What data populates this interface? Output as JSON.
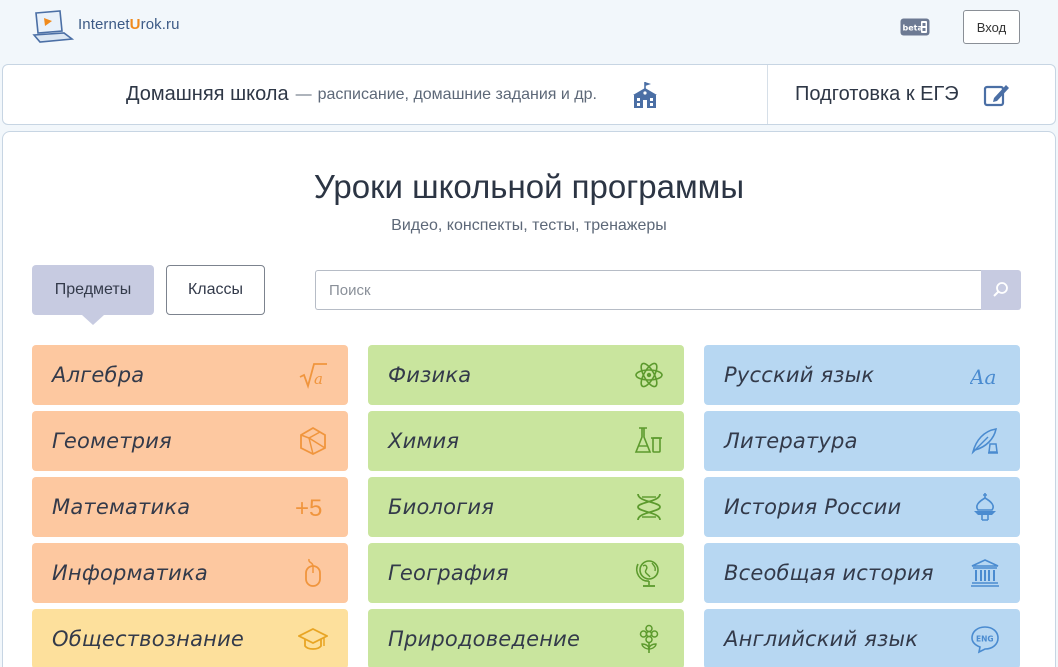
{
  "header": {
    "logo_prefix": "Internet",
    "logo_accent": "U",
    "logo_suffix": "rok.ru",
    "beta_label": "beta",
    "login_label": "Вход"
  },
  "topbar": {
    "home_school_title": "Домашняя школа",
    "dash": "—",
    "home_school_subtitle": "расписание, домашние задания и др.",
    "ege_title": "Подготовка к ЕГЭ"
  },
  "main": {
    "title": "Уроки школьной программы",
    "subtitle": "Видео, конспекты, тесты, тренажеры",
    "tab_subjects": "Предметы",
    "tab_classes": "Классы",
    "search_placeholder": "Поиск"
  },
  "subjects": {
    "col1": [
      {
        "label": "Алгебра",
        "icon": "square-root-icon",
        "color": "#fdc8a0"
      },
      {
        "label": "Геометрия",
        "icon": "polyhedron-icon",
        "color": "#fdc8a0"
      },
      {
        "label": "Математика",
        "icon": "plus-five-icon",
        "color": "#fdc8a0"
      },
      {
        "label": "Информатика",
        "icon": "mouse-icon",
        "color": "#fdc8a0"
      },
      {
        "label": "Обществознание",
        "icon": "graduation-cap-icon",
        "color": "#fde09c"
      }
    ],
    "col2": [
      {
        "label": "Физика",
        "icon": "atom-icon",
        "color": "#c9e59e"
      },
      {
        "label": "Химия",
        "icon": "flask-icon",
        "color": "#c9e59e"
      },
      {
        "label": "Биология",
        "icon": "dna-icon",
        "color": "#c9e59e"
      },
      {
        "label": "География",
        "icon": "globe-icon",
        "color": "#c9e59e"
      },
      {
        "label": "Природоведение",
        "icon": "flower-icon",
        "color": "#c9e59e"
      }
    ],
    "col3": [
      {
        "label": "Русский язык",
        "icon": "letters-icon",
        "color": "#b7d7f2"
      },
      {
        "label": "Литература",
        "icon": "quill-icon",
        "color": "#b7d7f2"
      },
      {
        "label": "История России",
        "icon": "church-dome-icon",
        "color": "#b7d7f2"
      },
      {
        "label": "Всеобщая история",
        "icon": "temple-icon",
        "color": "#b7d7f2"
      },
      {
        "label": "Английский язык",
        "icon": "eng-bubble-icon",
        "color": "#b7d7f2"
      }
    ],
    "plus_five_text": "+5",
    "eng_text": "ENG",
    "letters_text": "Aa"
  },
  "colors": {
    "orange_icon": "#f0953d",
    "green_icon": "#5c9a2d",
    "blue_icon": "#4a8bd0",
    "yellow_icon": "#e8a524",
    "accent": "#c7cbe1"
  }
}
